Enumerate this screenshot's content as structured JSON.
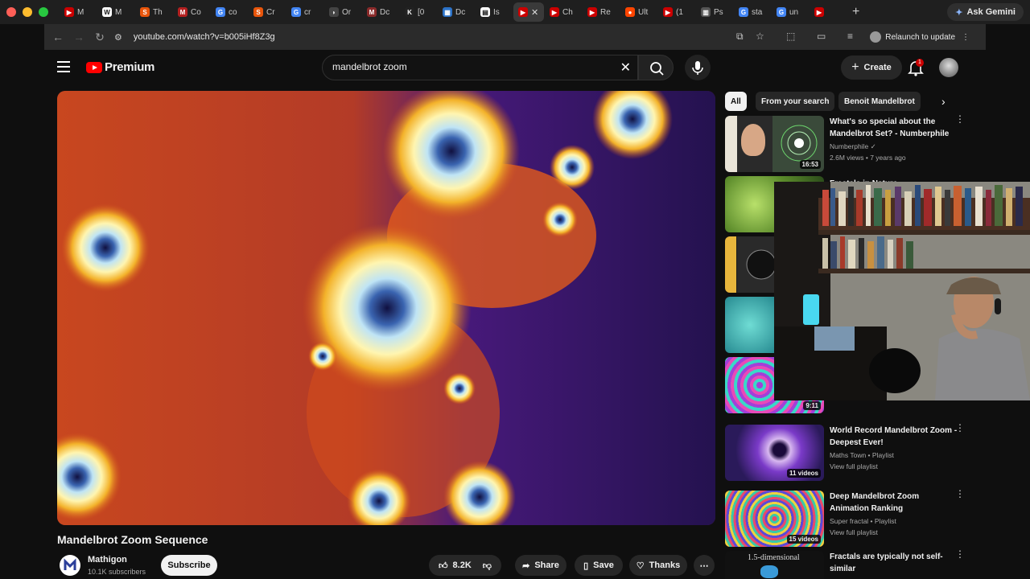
{
  "browser": {
    "tabs": [
      {
        "label": "M",
        "color": "#cc0000",
        "glyph": "▶"
      },
      {
        "label": "M",
        "color": "#ffffff",
        "glyph": "W"
      },
      {
        "label": "Th",
        "color": "#e8550b",
        "glyph": "S"
      },
      {
        "label": "Co",
        "color": "#b32020",
        "glyph": "M"
      },
      {
        "label": "co",
        "color": "#4285f4",
        "glyph": "G"
      },
      {
        "label": "Cr",
        "color": "#e8550b",
        "glyph": "S"
      },
      {
        "label": "cr",
        "color": "#4285f4",
        "glyph": "G"
      },
      {
        "label": "Or",
        "color": "#444",
        "glyph": "◗"
      },
      {
        "label": "Dc",
        "color": "#8a2a2a",
        "glyph": "M"
      },
      {
        "label": "[0",
        "color": "#222",
        "glyph": "K"
      },
      {
        "label": "Dc",
        "color": "#2b72c8",
        "glyph": "▦"
      },
      {
        "label": "Is",
        "color": "#ffffff",
        "glyph": "▤"
      },
      {
        "label": "",
        "color": "#cc0000",
        "glyph": "▶",
        "active": true
      },
      {
        "label": "Ch",
        "color": "#cc0000",
        "glyph": "▶"
      },
      {
        "label": "Re",
        "color": "#cc0000",
        "glyph": "▶"
      },
      {
        "label": "Ult",
        "color": "#ff4500",
        "glyph": "●"
      },
      {
        "label": "(1",
        "color": "#cc0000",
        "glyph": "▶"
      },
      {
        "label": "Ps",
        "color": "#555",
        "glyph": "▥"
      },
      {
        "label": "sta",
        "color": "#4285f4",
        "glyph": "G"
      },
      {
        "label": "un",
        "color": "#4285f4",
        "glyph": "G"
      },
      {
        "label": "",
        "color": "#cc0000",
        "glyph": "▶"
      }
    ],
    "ask_gemini": "Ask Gemini",
    "url": "youtube.com/watch?v=b005iHf8Z3g",
    "relaunch": "Relaunch to update"
  },
  "youtube": {
    "logo_text": "Premium",
    "search_value": "mandelbrot zoom",
    "create_label": "Create",
    "notif_count": "1",
    "video": {
      "title": "Mandelbrot Zoom Sequence",
      "channel": "Mathigon",
      "subscribers": "10.1K subscribers",
      "subscribe": "Subscribe",
      "likes": "8.2K",
      "share": "Share",
      "save": "Save",
      "thanks": "Thanks"
    },
    "chips": [
      "All",
      "From your search",
      "Benoit Mandelbrot"
    ],
    "recommendations": [
      {
        "title": "What's so special about the Mandelbrot Set? - Numberphile",
        "channel": "Numberphile",
        "meta": "2.6M views • 7 years ago",
        "duration": "16:53"
      },
      {
        "title": "Fractals in Nature",
        "channel": "",
        "meta": "",
        "duration": ""
      },
      {
        "title": "",
        "channel": "",
        "meta": "",
        "duration": ""
      },
      {
        "title": "",
        "channel": "",
        "meta": "",
        "duration": ""
      },
      {
        "title": "",
        "channel": "",
        "meta": "",
        "duration": "9:11"
      },
      {
        "title": "World Record Mandelbrot Zoom - Deepest Ever!",
        "channel": "Maths Town • Playlist",
        "meta": "View full playlist",
        "duration": "11 videos"
      },
      {
        "title": "Deep Mandelbrot Zoom Animation Ranking",
        "channel": "Super fractal • Playlist",
        "meta": "View full playlist",
        "duration": "15 videos"
      },
      {
        "title": "Fractals are typically not self-similar",
        "channel": "",
        "meta": "",
        "duration": "",
        "thumb_text": "1.5-dimensional"
      }
    ]
  }
}
